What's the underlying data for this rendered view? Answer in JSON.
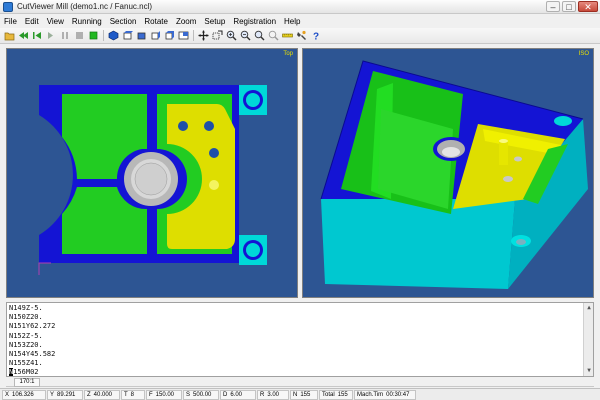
{
  "window": {
    "title": "CutViewer Mill (demo1.nc / Fanuc.ncl)",
    "minimize": "–",
    "maximize": "□",
    "close": "✕"
  },
  "menu": [
    "File",
    "Edit",
    "View",
    "Running",
    "Section",
    "Rotate",
    "Zoom",
    "Setup",
    "Registration",
    "Help"
  ],
  "toolbar_icons": [
    "open-icon",
    "rewind-icon",
    "step-back-icon",
    "step-icon",
    "pause-icon",
    "stop-icon",
    "run-icon",
    "view-solid-icon",
    "view-top-icon",
    "view-front-icon",
    "view-side-icon",
    "view-iso-icon",
    "view-split-icon",
    "pan-icon",
    "zoom-window-icon",
    "zoom-in-icon",
    "zoom-out-icon",
    "zoom-fit-icon",
    "zoom-all-icon",
    "measure-icon",
    "tool-icon",
    "help-icon"
  ],
  "viewports": {
    "top_label": "Top",
    "iso_label": "ISO"
  },
  "colors": {
    "background": "#2d5593",
    "stock_blue": "#1414d4",
    "pocket_green": "#22cc22",
    "floor_yellow": "#dede00",
    "cyan_stock": "#00d8d8",
    "hole": "#c8c8c8"
  },
  "code_lines": [
    "N149Z-5.",
    "N150Z20.",
    "N151Y62.272",
    "N152Z-5.",
    "N153Z20.",
    "N154Y45.582",
    "N155Z41.",
    "N156M02"
  ],
  "current_line": {
    "caret": "N",
    "rest": "156M02"
  },
  "line_indicator": "170:1",
  "status": [
    {
      "key": "X",
      "value": "106.326"
    },
    {
      "key": "Y",
      "value": "89.291"
    },
    {
      "key": "Z",
      "value": "40.000"
    },
    {
      "key": "T",
      "value": "8"
    },
    {
      "key": "F",
      "value": "150.00"
    },
    {
      "key": "S",
      "value": "500.00"
    },
    {
      "key": "D",
      "value": "6.00"
    },
    {
      "key": "R",
      "value": "3.00"
    },
    {
      "key": "N",
      "value": "155"
    },
    {
      "key": "Total",
      "value": "155"
    },
    {
      "key": "Mach.Tim",
      "value": "00:30:47"
    }
  ]
}
